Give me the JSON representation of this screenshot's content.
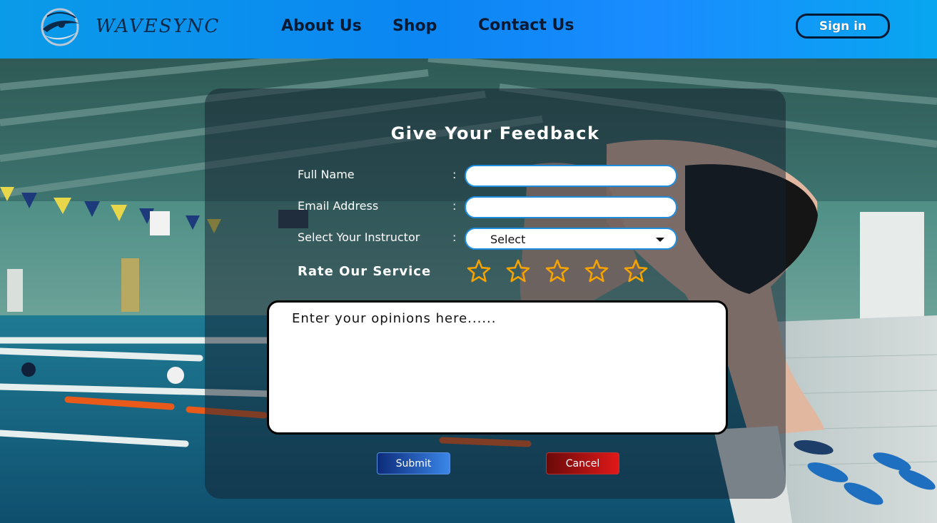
{
  "header": {
    "brand": "WAVESYNC",
    "logo_icon": "eye-wave-logo",
    "nav": [
      {
        "label": "About Us"
      },
      {
        "label": "Shop"
      },
      {
        "label": "Contact Us"
      }
    ],
    "signin_label": "Sign in"
  },
  "form": {
    "title": "Give Your Feedback",
    "colon": ":",
    "full_name": {
      "label": "Full Name",
      "value": "",
      "placeholder": ""
    },
    "email": {
      "label": "Email Address",
      "value": "",
      "placeholder": ""
    },
    "instructor": {
      "label": "Select Your Instructor",
      "selected": "Select"
    },
    "rating": {
      "label": "Rate Our Service",
      "max": 5,
      "value": 0,
      "star_icon": "star-outline-icon",
      "star_color": "#f5a300"
    },
    "opinions": {
      "placeholder": "Enter your opinions here......",
      "value": ""
    },
    "submit_label": "Submit",
    "cancel_label": "Cancel"
  },
  "colors": {
    "header_blue": "#0b86f2",
    "input_border": "#1e8fe0",
    "submit_blue": "#3a86e8",
    "cancel_red": "#e01919"
  }
}
